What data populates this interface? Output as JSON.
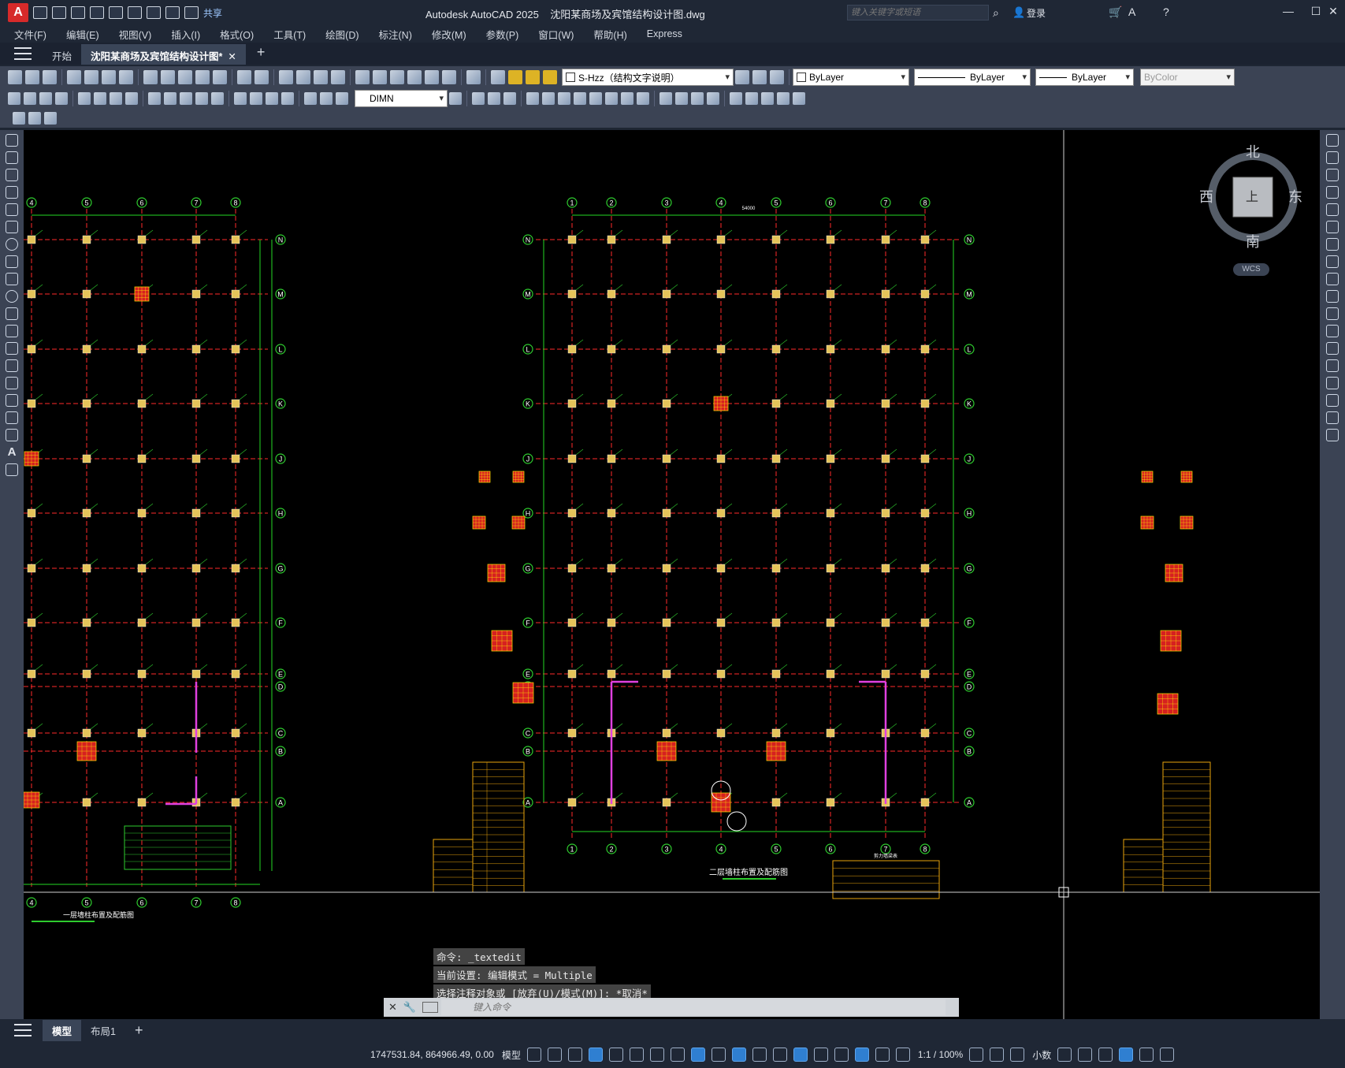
{
  "title_bar": {
    "app_title": "Autodesk AutoCAD 2025",
    "file_name": "沈阳某商场及宾馆结构设计图.dwg",
    "share_label": "共享",
    "search_placeholder": "键入关键字或短语",
    "login_label": "登录"
  },
  "menu": [
    "文件(F)",
    "编辑(E)",
    "视图(V)",
    "插入(I)",
    "格式(O)",
    "工具(T)",
    "绘图(D)",
    "标注(N)",
    "修改(M)",
    "参数(P)",
    "窗口(W)",
    "帮助(H)",
    "Express"
  ],
  "doc_tabs": {
    "start": "开始",
    "active": "沈阳某商场及宾馆结构设计图*"
  },
  "properties_toolbar": {
    "layer": "S-Hzz（结构文字说明）",
    "color": "ByLayer",
    "linetype": "ByLayer",
    "lineweight": "ByLayer",
    "plotstyle": "ByColor",
    "dimstyle": "DIMN"
  },
  "viewcube": {
    "north": "北",
    "south": "南",
    "east": "东",
    "west": "西",
    "face": "上",
    "wcs": "WCS"
  },
  "drawing": {
    "grid_left_top": [
      "4",
      "5",
      "6",
      "7",
      "8"
    ],
    "grid_mid_top": [
      "1",
      "2",
      "3",
      "4",
      "5",
      "6",
      "7",
      "8"
    ],
    "grid_rows": [
      "N",
      "M",
      "L",
      "K",
      "J",
      "H",
      "G",
      "F",
      "E",
      "D",
      "C",
      "B",
      "A"
    ],
    "title_mid": "二层墙柱布置及配筋图",
    "title_left": "一层墙柱布置及配筋图",
    "table_title": "剪力墙梁表",
    "dim_total": "54000"
  },
  "command": {
    "history": [
      "命令: _textedit",
      "当前设置: 编辑模式 = Multiple",
      "选择注释对象或 [放弃(U)/模式(M)]: *取消*"
    ],
    "placeholder": "键入命令"
  },
  "layout_tabs": {
    "model": "模型",
    "layout1": "布局1"
  },
  "status_bar": {
    "coordinates": "1747531.84, 864966.49, 0.00",
    "model_label": "模型",
    "scale": "1:1 / 100%",
    "units": "小数"
  },
  "colors": {
    "canvas": "#000000",
    "grid_line": "#ff2a2a",
    "dim_line": "#25d725",
    "column": "#d62020",
    "column_tag": "#e5c45a",
    "wall_magenta": "#e040e0",
    "bubble": "#2ecc2e",
    "table_yellow": "#e8a30c"
  }
}
